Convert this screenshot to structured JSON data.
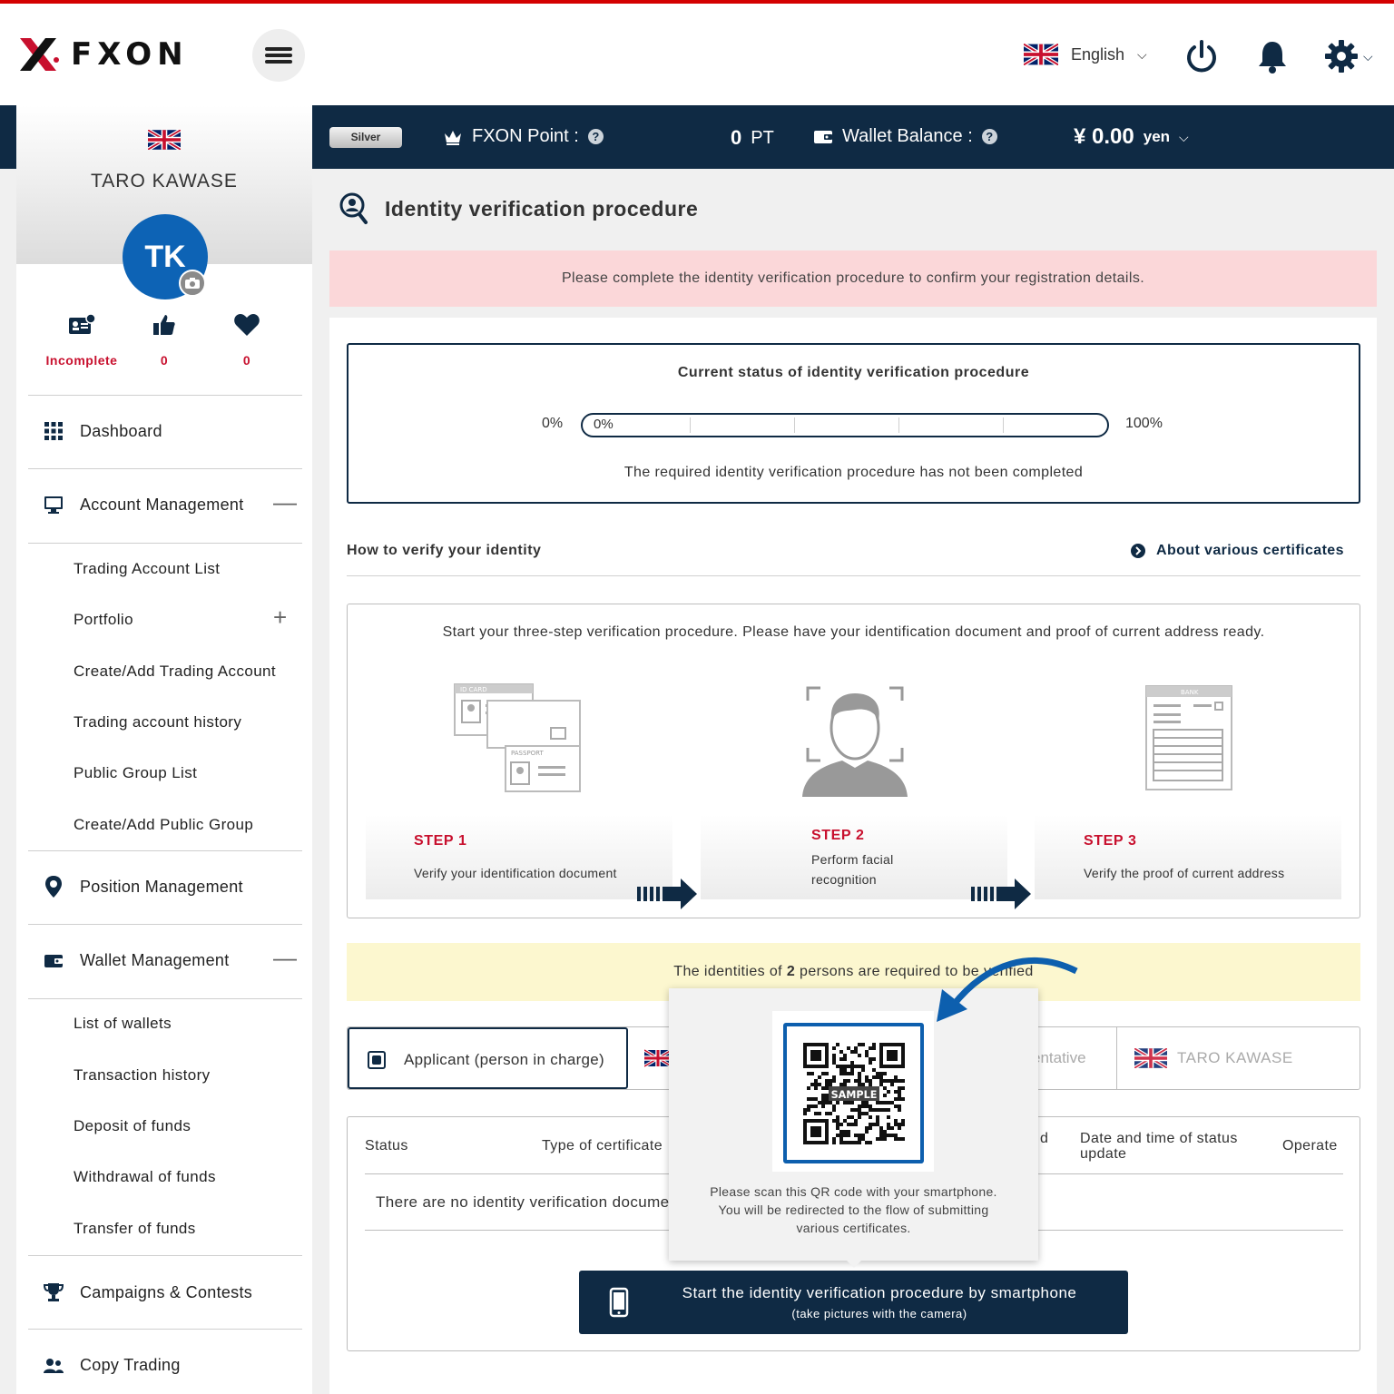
{
  "header": {
    "logo_text": "FXON",
    "language": "English",
    "icons": [
      "menu-icon",
      "uk-flag-icon",
      "power-icon",
      "bell-icon",
      "gear-icon"
    ]
  },
  "topbar": {
    "rank": "Silver",
    "point_label": "FXON Point :",
    "point_value": "0",
    "point_unit": "PT",
    "wallet_label": "Wallet Balance :",
    "wallet_value": "¥ 0.00",
    "wallet_unit": "yen"
  },
  "profile": {
    "name": "TARO KAWASE",
    "initials": "TK",
    "stats": [
      {
        "icon": "id-card-icon",
        "value": "Incomplete"
      },
      {
        "icon": "thumbs-up-icon",
        "value": "0"
      },
      {
        "icon": "heart-icon",
        "value": "0"
      }
    ]
  },
  "sidebar": {
    "dashboard": "Dashboard",
    "account_management": "Account Management",
    "account_items": [
      "Trading Account List",
      "Portfolio",
      "Create/Add Trading Account",
      "Trading account history",
      "Public Group List",
      "Create/Add Public Group"
    ],
    "position_management": "Position Management",
    "wallet_management": "Wallet Management",
    "wallet_items": [
      "List of wallets",
      "Transaction history",
      "Deposit of funds",
      "Withdrawal of funds",
      "Transfer of funds"
    ],
    "campaigns": "Campaigns & Contests",
    "copy_trading": "Copy Trading"
  },
  "main": {
    "title": "Identity verification procedure",
    "alert": "Please complete the identity verification procedure to confirm your registration details.",
    "status_title": "Current status of identity verification procedure",
    "progress_min": "0%",
    "progress_max": "100%",
    "progress_value": "0%",
    "progress_fraction": 0,
    "status_note": "The required identity verification procedure has not been completed",
    "howto": "How to verify your identity",
    "about": "About various certificates",
    "steps_intro": "Start your three-step verification procedure. Please have your identification document and proof of current address ready.",
    "illustration_labels": {
      "id_card": "ID CARD",
      "passport": "PASSPORT",
      "bank": "BANK"
    },
    "steps": [
      {
        "label": "STEP 1",
        "desc": "Verify your identification document"
      },
      {
        "label": "STEP 2",
        "desc_line1": "Perform facial",
        "desc_line2": "recognition"
      },
      {
        "label": "STEP 3",
        "desc": "Verify the proof of current address"
      }
    ],
    "persons_pre": "The identities of ",
    "persons_count": "2",
    "persons_post": " persons are required to be verified",
    "applicant_label": "Applicant (person in charge)",
    "representative_partial": "entative",
    "representative_name": "TARO KAWASE",
    "table_headers": {
      "status": "Status",
      "type": "Type of certificate",
      "date_line1": "Date and time of status",
      "date_line2": "update",
      "operate": "Operate"
    },
    "no_docs": "There are no identity verification documents",
    "sp_button_line1": "Start the identity verification procedure by smartphone",
    "sp_button_line2": "(take pictures with the camera)"
  },
  "qr_popup": {
    "sample": "SAMPLE",
    "line1": "Please scan this QR code with your smartphone.",
    "line2": "You will be redirected to the flow of submitting",
    "line3": "various certificates."
  },
  "colors": {
    "navy": "#0f2a44",
    "red": "#c8102e",
    "alert_bg": "#fbd7d9",
    "notice_bg": "#fcf7cf",
    "avatar": "#0d63b5"
  }
}
